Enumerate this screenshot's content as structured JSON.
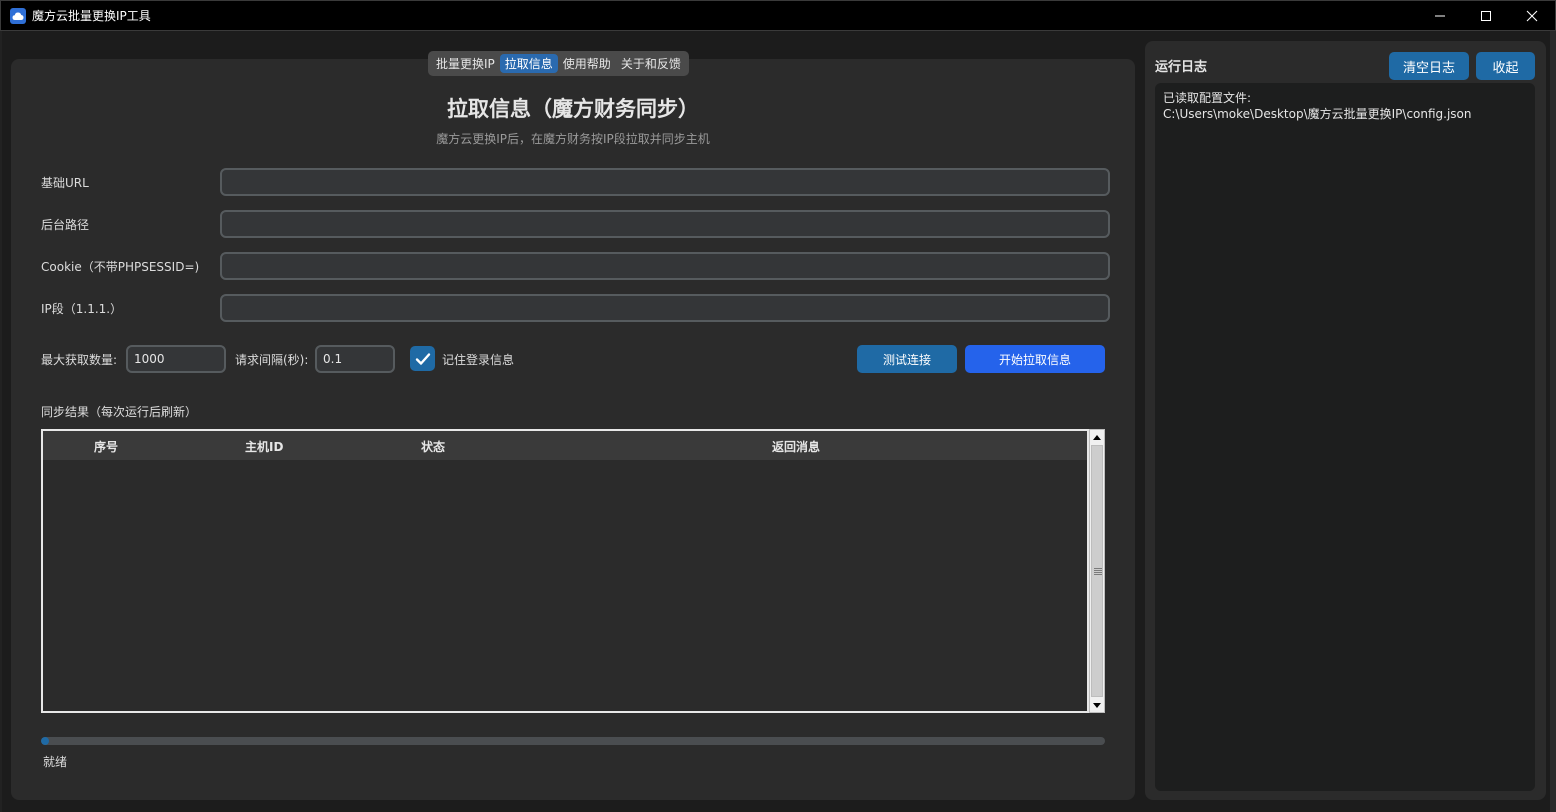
{
  "window": {
    "title": "魔方云批量更换IP工具",
    "icon": "cloud-icon",
    "controls": [
      "minimize-icon",
      "maximize-icon",
      "close-icon"
    ]
  },
  "tabs": [
    {
      "label": "批量更换IP",
      "active": false
    },
    {
      "label": "拉取信息",
      "active": true
    },
    {
      "label": "使用帮助",
      "active": false
    },
    {
      "label": "关于和反馈",
      "active": false
    }
  ],
  "page": {
    "title": "拉取信息（魔方财务同步）",
    "subtitle": "魔方云更换IP后，在魔方财务按IP段拉取并同步主机"
  },
  "form": {
    "base_url_label": "基础URL",
    "base_url_value": "",
    "admin_path_label": "后台路径",
    "admin_path_value": "",
    "cookie_label": "Cookie（不带PHPSESSID=)",
    "cookie_value": "",
    "ip_segment_label": "IP段（1.1.1.）",
    "ip_segment_value": "",
    "max_fetch_label": "最大获取数量:",
    "max_fetch_value": "1000",
    "interval_label": "请求间隔(秒):",
    "interval_value": "0.1",
    "remember_label": "记住登录信息",
    "remember_checked": true
  },
  "buttons": {
    "test_connection": "测试连接",
    "start_fetch": "开始拉取信息"
  },
  "results": {
    "section_label": "同步结果（每次运行后刷新）",
    "columns": [
      "序号",
      "主机ID",
      "状态",
      "返回消息"
    ],
    "rows": []
  },
  "progress": {
    "fraction": 0.0,
    "status": "就绪"
  },
  "log": {
    "title": "运行日志",
    "clear_button": "清空日志",
    "collapse_button": "收起",
    "content": "已读取配置文件:\nC:\\Users\\moke\\Desktop\\魔方云批量更换IP\\config.json"
  },
  "colors": {
    "accent": "#1f6aa5",
    "primary_button": "#2563eb",
    "background": "#2b2b2b",
    "titlebar": "#000000"
  }
}
